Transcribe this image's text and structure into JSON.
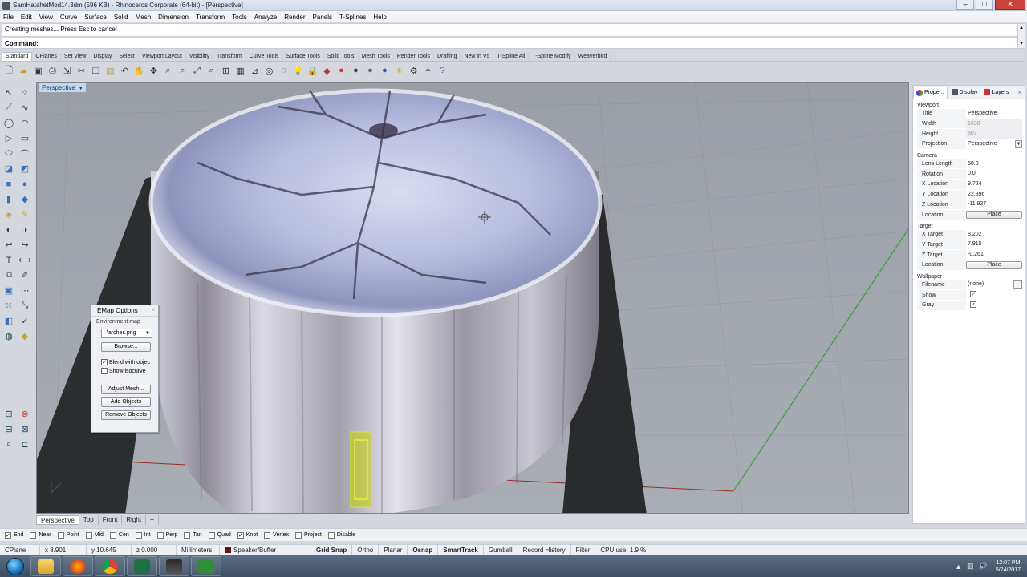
{
  "window": {
    "title": "SamHatahetMod14.3dm (596 KB) - Rhinoceros Corporate (64-bit) - [Perspective]",
    "buttons": [
      "–",
      "□",
      "✕"
    ]
  },
  "menu": [
    "File",
    "Edit",
    "View",
    "Curve",
    "Surface",
    "Solid",
    "Mesh",
    "Dimension",
    "Transform",
    "Tools",
    "Analyze",
    "Render",
    "Panels",
    "T-Splines",
    "Help"
  ],
  "command": {
    "history": "Creating meshes... Press Esc to cancel",
    "prompt_label": "Command:",
    "value": ""
  },
  "toolbar_tabs": [
    "Standard",
    "CPlanes",
    "Set View",
    "Display",
    "Select",
    "Viewport Layout",
    "Visibility",
    "Transform",
    "Curve Tools",
    "Surface Tools",
    "Solid Tools",
    "Mesh Tools",
    "Render Tools",
    "Drafting",
    "New in V5",
    "T-Spline All",
    "T-Spline Modify",
    "Weaverbird"
  ],
  "toolbar_icons": [
    "new-icon",
    "open-icon",
    "save-icon",
    "print-icon",
    "import-icon",
    "cut-icon",
    "copy-icon",
    "paste-icon",
    "undo-icon",
    "pan-icon",
    "rotate-view-icon",
    "zoom-icon",
    "zoom-window-icon",
    "zoom-extents-icon",
    "zoom-selected-icon",
    "four-viewports-icon",
    "grid-icon",
    "cplane-icon",
    "camera-icon",
    "ghosted-icon",
    "light-icon",
    "lock-icon",
    "layer-icon",
    "color-sphere-icon",
    "render-sphere-icon",
    "material-sphere-icon",
    "env-sphere-icon",
    "sun-icon",
    "gear-icon",
    "dimension-icon",
    "help-icon"
  ],
  "viewport": {
    "title": "Perspective"
  },
  "emap": {
    "title": "EMap Options",
    "group": "Environment map",
    "file": "\\arches.png",
    "browse": "Browse...",
    "blend_label": "Blend with objec",
    "blend_checked": true,
    "isocurve_label": "Show isocurve",
    "isocurve_checked": false,
    "adjust_mesh": "Adjust Mesh...",
    "add_objects": "Add Objects",
    "remove_objects": "Remove Objects"
  },
  "panel": {
    "tabs": [
      "Prope...",
      "Display",
      "Layers"
    ],
    "viewport_section": "Viewport",
    "title_label": "Title",
    "title_value": "Perspective",
    "width_label": "Width",
    "width_value": "1630",
    "height_label": "Height",
    "height_value": "807",
    "projection_label": "Projection",
    "projection_value": "Perspective",
    "camera_section": "Camera",
    "lens_label": "Lens Length",
    "lens_value": "50.0",
    "rotation_label": "Rotation",
    "rotation_value": "0.0",
    "xloc_label": "X Location",
    "xloc_value": "9.724",
    "yloc_label": "Y Location",
    "yloc_value": "22.396",
    "zloc_label": "Z Location",
    "zloc_value": "-11.927",
    "location_label": "Location",
    "place_label": "Place",
    "target_section": "Target",
    "xtarget_label": "X Target",
    "xtarget_value": "8.202",
    "ytarget_label": "Y Target",
    "ytarget_value": "7.915",
    "ztarget_label": "Z Target",
    "ztarget_value": "-0.261",
    "tlocation_label": "Location",
    "tplace_label": "Place",
    "wallpaper_section": "Wallpaper",
    "filename_label": "Filename",
    "filename_value": "(none)",
    "show_label": "Show",
    "show_checked": true,
    "gray_label": "Gray",
    "gray_checked": true
  },
  "viewport_tabs": [
    "Perspective",
    "Top",
    "Front",
    "Right",
    "+"
  ],
  "osnaps": [
    {
      "label": "End",
      "checked": true
    },
    {
      "label": "Near",
      "checked": false
    },
    {
      "label": "Point",
      "checked": false
    },
    {
      "label": "Mid",
      "checked": false
    },
    {
      "label": "Cen",
      "checked": false
    },
    {
      "label": "Int",
      "checked": false
    },
    {
      "label": "Perp",
      "checked": false
    },
    {
      "label": "Tan",
      "checked": false
    },
    {
      "label": "Quad",
      "checked": false
    },
    {
      "label": "Knot",
      "checked": true
    },
    {
      "label": "Vertex",
      "checked": false
    },
    {
      "label": "Project",
      "checked": false
    },
    {
      "label": "Disable",
      "checked": false
    }
  ],
  "status": {
    "cplane": "CPlane",
    "x": "x 8.901",
    "y": "y 10.645",
    "z": "z 0.000",
    "units": "Millimeters",
    "layer": "Speaker/Buffer",
    "grid_snap": "Grid Snap",
    "ortho": "Ortho",
    "planar": "Planar",
    "osnap": "Osnap",
    "smarttrack": "SmartTrack",
    "gumball": "Gumball",
    "record_history": "Record History",
    "filter": "Filter",
    "cpu": "CPU use: 1.9 %"
  },
  "taskbar": {
    "time": "12:07 PM",
    "date": "5/24/2017"
  },
  "colors": {
    "viewport_bg": "#9da2a9",
    "accent": "#c3d7ef",
    "selection": "#d4f000"
  }
}
